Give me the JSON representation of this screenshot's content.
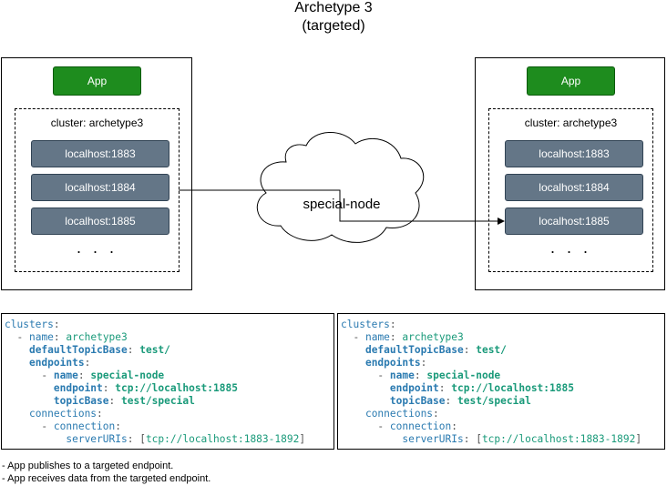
{
  "title": {
    "line1": "Archetype 3",
    "line2": "(targeted)"
  },
  "left": {
    "app_label": "App",
    "cluster_label": "cluster: archetype3",
    "nodes": [
      "localhost:1883",
      "localhost:1884",
      "localhost:1885"
    ],
    "ellipsis": ". . ."
  },
  "right": {
    "app_label": "App",
    "cluster_label": "cluster: archetype3",
    "nodes": [
      "localhost:1883",
      "localhost:1884",
      "localhost:1885"
    ],
    "ellipsis": ". . ."
  },
  "cloud_label": "special-node",
  "config_left": {
    "clusters_key": "clusters",
    "name_key": "name",
    "name_value": "archetype3",
    "default_topic_key": "defaultTopicBase",
    "default_topic_value": "test/",
    "endpoints_key": "endpoints",
    "ep_name_key": "name",
    "ep_name_value": "special-node",
    "ep_endpoint_key": "endpoint",
    "ep_endpoint_value": "tcp://localhost:1885",
    "ep_topic_key": "topicBase",
    "ep_topic_value": "test/special",
    "connections_key": "connections",
    "connection_key": "connection",
    "server_uris_key": "serverURIs",
    "server_uris_value": "tcp://localhost:1883-1892"
  },
  "config_right": {
    "clusters_key": "clusters",
    "name_key": "name",
    "name_value": "archetype3",
    "default_topic_key": "defaultTopicBase",
    "default_topic_value": "test/",
    "endpoints_key": "endpoints",
    "ep_name_key": "name",
    "ep_name_value": "special-node",
    "ep_endpoint_key": "endpoint",
    "ep_endpoint_value": "tcp://localhost:1885",
    "ep_topic_key": "topicBase",
    "ep_topic_value": "test/special",
    "connections_key": "connections",
    "connection_key": "connection",
    "server_uris_key": "serverURIs",
    "server_uris_value": "tcp://localhost:1883-1892"
  },
  "notes": [
    "- App publishes to a targeted endpoint.",
    "- App receives data from the targeted endpoint."
  ]
}
